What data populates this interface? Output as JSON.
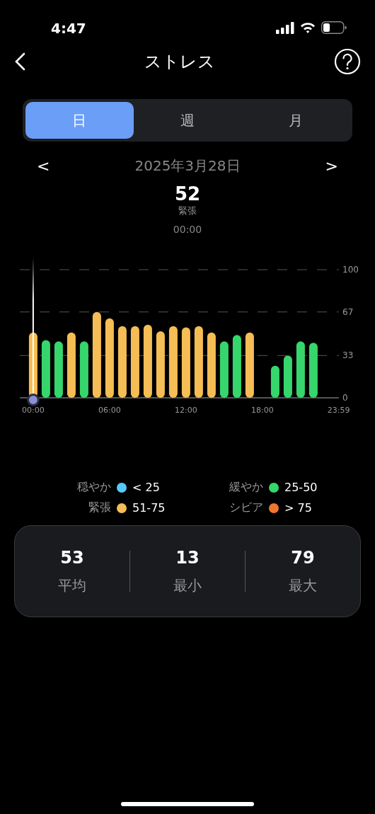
{
  "status_bar": {
    "time": "4:47"
  },
  "header": {
    "title": "ストレス"
  },
  "tabs": [
    {
      "label": "日",
      "selected": true
    },
    {
      "label": "週",
      "selected": false
    },
    {
      "label": "月",
      "selected": false
    }
  ],
  "date_nav": {
    "prev": "<",
    "date": "2025年3月28日",
    "next": ">"
  },
  "reading": {
    "value": "52",
    "state": "緊張",
    "time": "00:00"
  },
  "chart": {
    "chart_data": {
      "type": "bar",
      "x": [
        0,
        60,
        120,
        180,
        240,
        300,
        360,
        420,
        480,
        540,
        600,
        660,
        720,
        780,
        840,
        900,
        960,
        1020,
        1140,
        1200,
        1260,
        1320
      ],
      "series": [
        {
          "color": "#f5bd55",
          "values": [
            51,
            null,
            null,
            51,
            null,
            67,
            62,
            56,
            56,
            57,
            52,
            56,
            55,
            56,
            51,
            null,
            null,
            51,
            null,
            null,
            null,
            null
          ]
        },
        {
          "color": "#36d66c",
          "values": [
            null,
            45,
            44,
            null,
            44,
            null,
            null,
            null,
            null,
            null,
            null,
            null,
            null,
            null,
            null,
            44,
            49,
            null,
            25,
            33,
            44,
            43
          ]
        }
      ],
      "xlim": [
        -63,
        1440
      ],
      "ylim": [
        0,
        100
      ],
      "yticks": [
        {
          "value": 0,
          "label": "0"
        },
        {
          "value": 33,
          "label": "33"
        },
        {
          "value": 67,
          "label": "67"
        },
        {
          "value": 100,
          "label": "100"
        }
      ],
      "xticks": [
        {
          "value": 0,
          "label": "00:00"
        },
        {
          "value": 360,
          "label": "06:00"
        },
        {
          "value": 720,
          "label": "12:00"
        },
        {
          "value": 1080,
          "label": "18:00"
        },
        {
          "value": 1439,
          "label": "23:59"
        }
      ]
    }
  },
  "legend": [
    {
      "label": "穏やか",
      "color": "#5ac8fa",
      "range": "< 25"
    },
    {
      "label": "緩やか",
      "color": "#36d66c",
      "range": "25-50"
    },
    {
      "label": "緊張",
      "color": "#f5bd55",
      "range": "51-75"
    },
    {
      "label": "シビア",
      "color": "#f0762e",
      "range": "> 75"
    }
  ],
  "summary": [
    {
      "value": "53",
      "label": "平均"
    },
    {
      "value": "13",
      "label": "最小"
    },
    {
      "value": "79",
      "label": "最大"
    }
  ]
}
